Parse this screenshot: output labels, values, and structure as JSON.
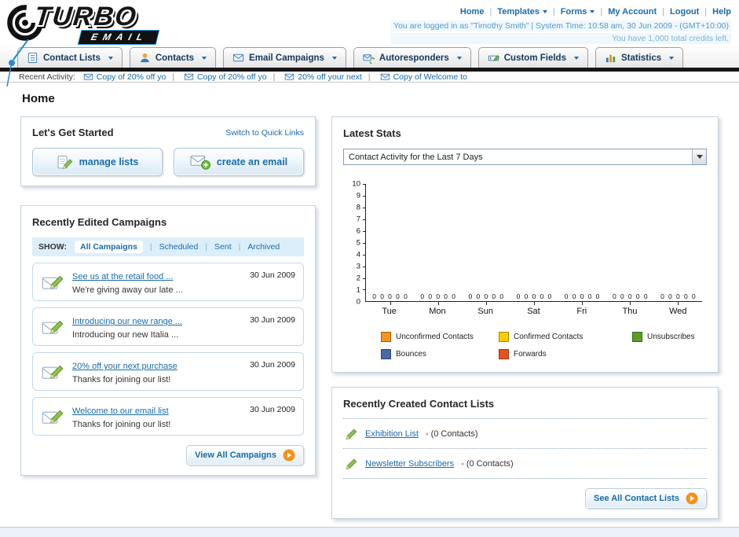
{
  "header": {
    "logo_line1": "TURBO",
    "logo_line2": "EMAIL",
    "nav_links": [
      {
        "label": "Home",
        "dropdown": false
      },
      {
        "label": "Templates",
        "dropdown": true
      },
      {
        "label": "Forms",
        "dropdown": true
      },
      {
        "label": "My Account",
        "dropdown": false
      },
      {
        "label": "Logout",
        "dropdown": false
      },
      {
        "label": "Help",
        "dropdown": false
      }
    ],
    "login_info": "You are logged in as \"Timothy Smith\" | System Time: 10:58 am, 30 Jun 2009 - (GMT+10:00)",
    "credits_info": "You have 1,000 total credits left."
  },
  "nav_tabs": [
    {
      "label": "Contact Lists",
      "icon": "list"
    },
    {
      "label": "Contacts",
      "icon": "contact"
    },
    {
      "label": "Email Campaigns",
      "icon": "mail"
    },
    {
      "label": "Autoresponders",
      "icon": "auto"
    },
    {
      "label": "Custom Fields",
      "icon": "field"
    },
    {
      "label": "Statistics",
      "icon": "stats"
    }
  ],
  "recent_activity": {
    "label": "Recent Activity:",
    "items": [
      "Copy of 20% off yo",
      "Copy of 20% off yo",
      "20% off your next",
      "Copy of Welcome to"
    ]
  },
  "page_title": "Home",
  "get_started": {
    "title": "Let's Get Started",
    "switch_link": "Switch to Quick Links",
    "manage_lists_label": "manage lists",
    "create_email_label": "create an email"
  },
  "campaigns": {
    "title": "Recently Edited Campaigns",
    "show_label": "SHOW:",
    "filters": [
      {
        "label": "All Campaigns",
        "active": true
      },
      {
        "label": "Scheduled",
        "active": false
      },
      {
        "label": "Sent",
        "active": false
      },
      {
        "label": "Archived",
        "active": false
      }
    ],
    "items": [
      {
        "title": "See us at the retail food ...",
        "subtitle": "We're giving away our late ...",
        "date": "30 Jun 2009"
      },
      {
        "title": "Introducing our new range ...",
        "subtitle": "Introducing our new Italia ...",
        "date": "30 Jun 2009"
      },
      {
        "title": "20% off your next purchase",
        "subtitle": "Thanks for joining our list!",
        "date": "30 Jun 2009"
      },
      {
        "title": "Welcome to our email list",
        "subtitle": "Thanks for joining our list!",
        "date": "30 Jun 2009"
      }
    ],
    "view_all_label": "View All Campaigns"
  },
  "stats": {
    "title": "Latest Stats",
    "dropdown_value": "Contact Activity for the Last 7 Days"
  },
  "chart_data": {
    "type": "bar",
    "title": "Contact Activity for the Last 7 Days",
    "categories": [
      "Tue",
      "Mon",
      "Sun",
      "Sat",
      "Fri",
      "Thu",
      "Wed"
    ],
    "series": [
      {
        "name": "Unconfirmed Contacts",
        "color": "#f7941d",
        "values": [
          0,
          0,
          0,
          0,
          0,
          0,
          0
        ]
      },
      {
        "name": "Confirmed Contacts",
        "color": "#ffcc00",
        "values": [
          0,
          0,
          0,
          0,
          0,
          0,
          0
        ]
      },
      {
        "name": "Unsubscribes",
        "color": "#5b9e26",
        "values": [
          0,
          0,
          0,
          0,
          0,
          0,
          0
        ]
      },
      {
        "name": "Bounces",
        "color": "#4a69a8",
        "values": [
          0,
          0,
          0,
          0,
          0,
          0,
          0
        ]
      },
      {
        "name": "Forwards",
        "color": "#e8501f",
        "values": [
          0,
          0,
          0,
          0,
          0,
          0,
          0
        ]
      }
    ],
    "ylim": [
      0,
      10
    ],
    "grid": false,
    "legend_position": "bottom"
  },
  "contact_lists": {
    "title": "Recently Created Contact Lists",
    "items": [
      {
        "name": "Exhibition List",
        "suffix": "- (0 Contacts)"
      },
      {
        "name": "Newsletter Subscribers",
        "suffix": "- (0 Contacts)"
      }
    ],
    "see_all_label": "See All Contact Lists"
  },
  "colors": {
    "link_blue": "#1a6ca8",
    "nav_bar_black": "#161616",
    "accent_orange": "#f59114"
  }
}
